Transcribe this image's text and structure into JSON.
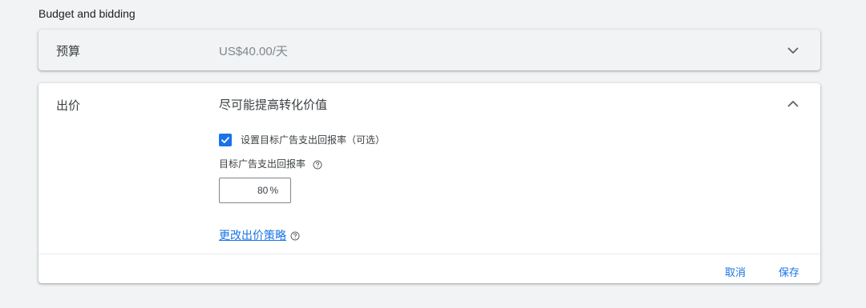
{
  "section": {
    "title": "Budget and bidding"
  },
  "budget": {
    "label": "预算",
    "value": "US$40.00/天",
    "expand_icon": "chevron-down-icon"
  },
  "bidding": {
    "label": "出价",
    "strategy": "尽可能提高转化价值",
    "collapse_icon": "chevron-up-icon",
    "target_roas_checkbox": {
      "label": "设置目标广告支出回报率（可选）",
      "checked": true
    },
    "target_roas_field": {
      "label": "目标广告支出回报率",
      "value": "80",
      "unit": "%",
      "help_icon": "help-icon"
    },
    "change_strategy_link": "更改出价策略",
    "cancel_label": "取消",
    "save_label": "保存"
  },
  "colors": {
    "accent": "#1a73e8",
    "page_bg": "#f1f3f4",
    "card_bg": "#ffffff",
    "text": "#3c4043",
    "muted_text": "#80868b"
  }
}
